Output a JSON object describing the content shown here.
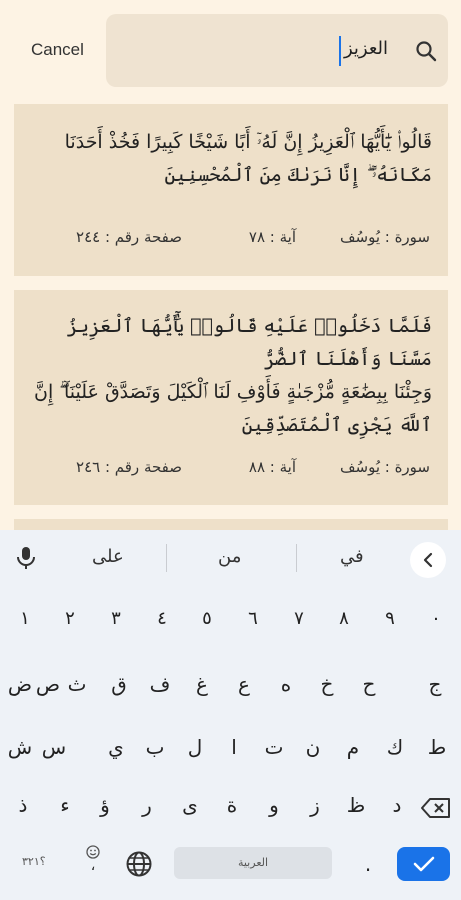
{
  "header": {
    "cancel_label": "Cancel",
    "search_query": "العزيز"
  },
  "results": [
    {
      "verse_lines": [
        "قَالُوا۟ يَٰٓأَيُّهَا ٱلْعَزِيزُ إِنَّ لَهُۥٓ أَبًا شَيْخًا كَبِيرًا فَخُذْ أَحَدَنَا",
        "مَكَانَهُۥٓ ۖ إِنَّا نَرَىٰكَ مِنَ ٱلْمُحْسِنِينَ"
      ],
      "surah": "سورة : يُوسُف",
      "ayah": "آية : ٧٨",
      "page": "صفحة رقم : ٢٤٤"
    },
    {
      "verse_lines": [
        "فَلَمَّا دَخَلُوا۟ عَلَيْهِ قَالُوا۟ يَٰٓأَيُّهَا ٱلْعَزِيزُ مَسَّنَا وَأَهْلَنَا ٱلضُّرُّ",
        "وَجِئْنَا بِبِضَٰعَةٍ مُّزْجَىٰةٍ فَأَوْفِ لَنَا ٱلْكَيْلَ وَتَصَدَّقْ عَلَيْنَآ ۖ إِنَّ",
        "ٱللَّهَ يَجْزِى ٱلْمُتَصَدِّقِينَ"
      ],
      "surah": "سورة : يُوسُف",
      "ayah": "آية : ٨٨",
      "page": "صفحة رقم : ٢٤٦"
    }
  ],
  "keyboard": {
    "suggestions": [
      "على",
      "من",
      "في"
    ],
    "digits": [
      "١",
      "٢",
      "٣",
      "٤",
      "٥",
      "٦",
      "٧",
      "٨",
      "٩",
      "٠"
    ],
    "row1": [
      "ض",
      "ص",
      "ث",
      "ق",
      "ف",
      "غ",
      "ع",
      "ه",
      "خ",
      "ح",
      "ج"
    ],
    "row2": [
      "ش",
      "س",
      "ي",
      "ب",
      "ل",
      "ا",
      "ت",
      "ن",
      "م",
      "ك",
      "ط"
    ],
    "row3": [
      "ذ",
      "ء",
      "ؤ",
      "ر",
      "ى",
      "ة",
      "و",
      "ز",
      "ظ",
      "د"
    ],
    "symbols_label": "؟٣٢١",
    "emoji_comma": "،",
    "space_label": "العربية",
    "period": ".",
    "accent_color": "#1a73e8"
  }
}
